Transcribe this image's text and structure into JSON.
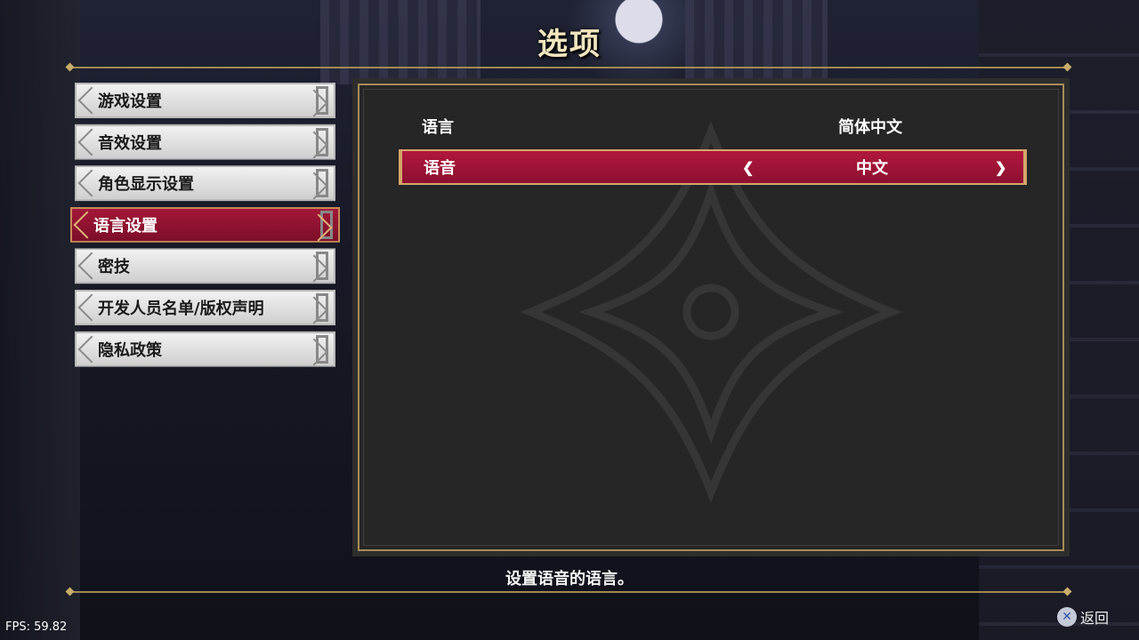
{
  "title": "选项",
  "menu": {
    "items": [
      {
        "label": "游戏设置"
      },
      {
        "label": "音效设置"
      },
      {
        "label": "角色显示设置"
      },
      {
        "label": "语言设置"
      },
      {
        "label": "密技"
      },
      {
        "label": "开发人员名单/版权声明"
      },
      {
        "label": "隐私政策"
      }
    ],
    "active_index": 3
  },
  "settings": {
    "rows": [
      {
        "label": "语言",
        "value": "简体中文"
      },
      {
        "label": "语音",
        "value": "中文"
      }
    ],
    "selected_index": 1
  },
  "description": "设置语音的语言。",
  "footer": {
    "back_label": "返回",
    "back_icon": "cross-icon",
    "fps": "FPS: 59.82"
  },
  "colors": {
    "accent_red": "#a41738",
    "gold": "#a58c57"
  }
}
